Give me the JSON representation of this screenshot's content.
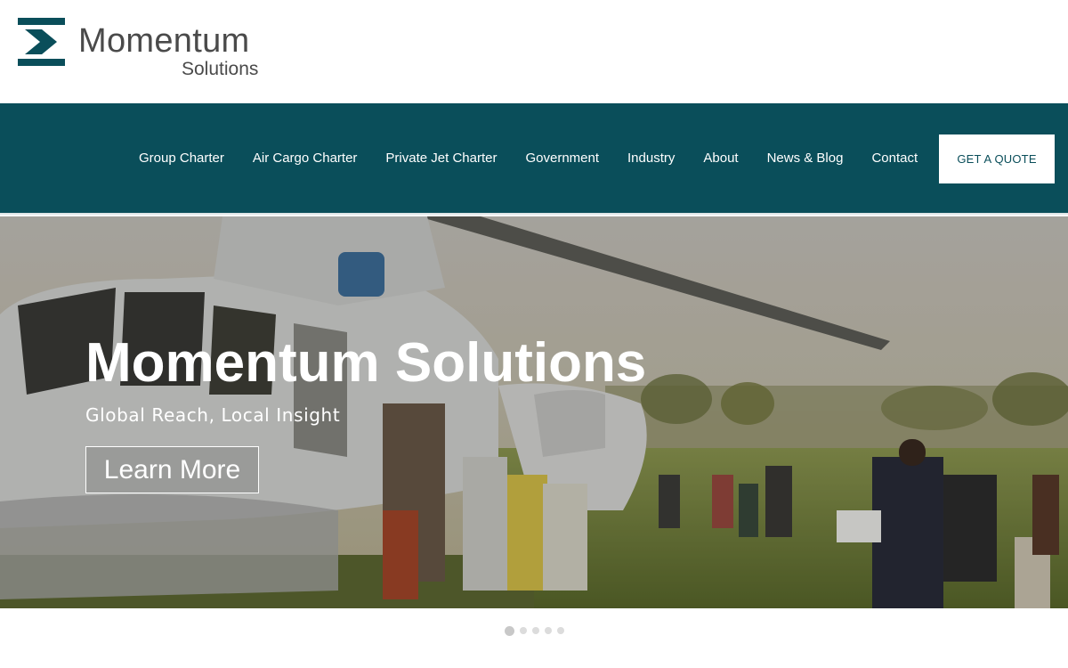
{
  "brand": {
    "name": "Momentum",
    "tagline": "Solutions",
    "color": "#0a4e5a"
  },
  "nav": {
    "items": [
      {
        "label": "Group Charter"
      },
      {
        "label": "Air Cargo Charter"
      },
      {
        "label": "Private Jet Charter"
      },
      {
        "label": "Government"
      },
      {
        "label": "Industry"
      },
      {
        "label": "About"
      },
      {
        "label": "News & Blog"
      },
      {
        "label": "Contact"
      }
    ],
    "cta_label": "GET A QUOTE"
  },
  "hero": {
    "title": "Momentum Solutions",
    "subtitle": "Global Reach, Local Insight",
    "button_label": "Learn More"
  },
  "carousel": {
    "slide_count": 5,
    "active_index": 0
  }
}
